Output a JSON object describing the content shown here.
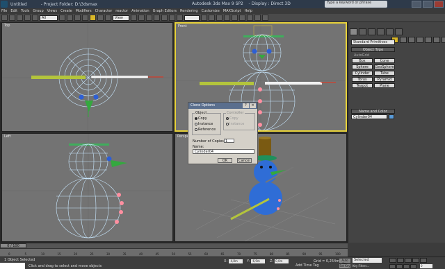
{
  "window": {
    "file": "Untitled",
    "project": "- Project Folder: D:\\3dsmax",
    "title": "Autodesk 3ds Max 9 SP2",
    "display": "- Display : Direct 3D",
    "help_placeholder": "Type a keyword or phrase"
  },
  "menu": [
    "File",
    "Edit",
    "Tools",
    "Group",
    "Views",
    "Create",
    "Modifiers",
    "Character",
    "reactor",
    "Animation",
    "Graph Editors",
    "Rendering",
    "Customize",
    "MAXScript",
    "Help"
  ],
  "toolbar": {
    "selection_filter": "All",
    "ref_coord": "View",
    "named_set": ""
  },
  "viewports": {
    "top": "Top",
    "front": "Front",
    "left": "Left",
    "perspective": "Perspective"
  },
  "command_panel": {
    "primitive_type": "Standard Primitives",
    "object_type_header": "Object Type",
    "autogrid": "AutoGrid",
    "buttons": [
      "Box",
      "Cone",
      "Sphere",
      "GeoSphere",
      "Cylinder",
      "Tube",
      "Torus",
      "Pyramid",
      "Teapot",
      "Plane"
    ],
    "name_color_header": "Name and Color",
    "object_name": "Cylinder04",
    "swatch_color": "#5a9bd8"
  },
  "dialog": {
    "title": "Clone Options",
    "object_group": "Object",
    "object_options": [
      "Copy",
      "Instance",
      "Reference"
    ],
    "controller_group": "Controller",
    "controller_options": [
      "Copy",
      "Instance"
    ],
    "copies_label": "Number of Copies:",
    "copies_value": "1",
    "name_label": "Name:",
    "name_value": "Cylinder04",
    "ok": "OK",
    "cancel": "Cancel"
  },
  "timeline": {
    "slider_label": "0 / 100",
    "ticks": [
      "0",
      "5",
      "10",
      "15",
      "20",
      "25",
      "30",
      "35",
      "40",
      "45",
      "50",
      "55",
      "60",
      "65",
      "70",
      "75",
      "80",
      "85",
      "90",
      "95",
      "100"
    ]
  },
  "status": {
    "selected": "1 Object Selected",
    "prompt": "Click and drag to select and move objects",
    "x_label": "X:",
    "x": "-4,8m",
    "y_label": "Y:",
    "y": "-6,9m",
    "z_label": "Z:",
    "z": "0,0m",
    "grid": "Grid = 0,254m",
    "add_time_tag": "Add Time Tag",
    "auto_key": "Auto Key",
    "set_key": "Set Key",
    "key_mode": "Selected",
    "key_filters": "Key Filters...",
    "frame": "0"
  }
}
